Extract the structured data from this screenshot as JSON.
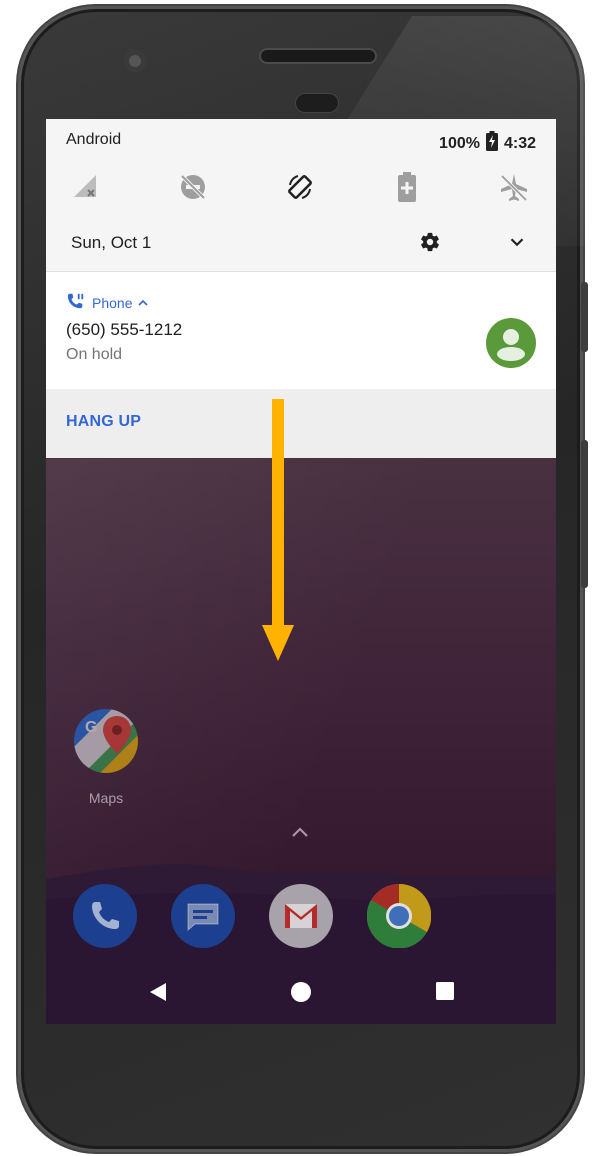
{
  "status_bar": {
    "carrier": "Android",
    "battery_text": "100%",
    "time": "4:32"
  },
  "quick_settings": {
    "tiles": [
      {
        "icon": "no-signal-icon"
      },
      {
        "icon": "do-not-disturb-off-icon"
      },
      {
        "icon": "auto-rotate-icon"
      },
      {
        "icon": "battery-saver-icon"
      },
      {
        "icon": "airplane-mode-icon"
      }
    ],
    "date": "Sun, Oct 1",
    "settings_icon": "gear-icon",
    "expand_icon": "chevron-down-icon"
  },
  "notification": {
    "app_name": "Phone",
    "caller": "(650) 555-1212",
    "status": "On hold",
    "action": "HANG UP",
    "accent_color": "#3367d6",
    "avatar_color": "#5a9a3a"
  },
  "home": {
    "app_label": "Maps",
    "dock": [
      {
        "icon": "phone-app-icon"
      },
      {
        "icon": "messages-app-icon"
      },
      {
        "icon": "gmail-app-icon"
      },
      {
        "icon": "chrome-app-icon"
      }
    ]
  },
  "annotation": {
    "arrow_color": "#ffb300"
  }
}
